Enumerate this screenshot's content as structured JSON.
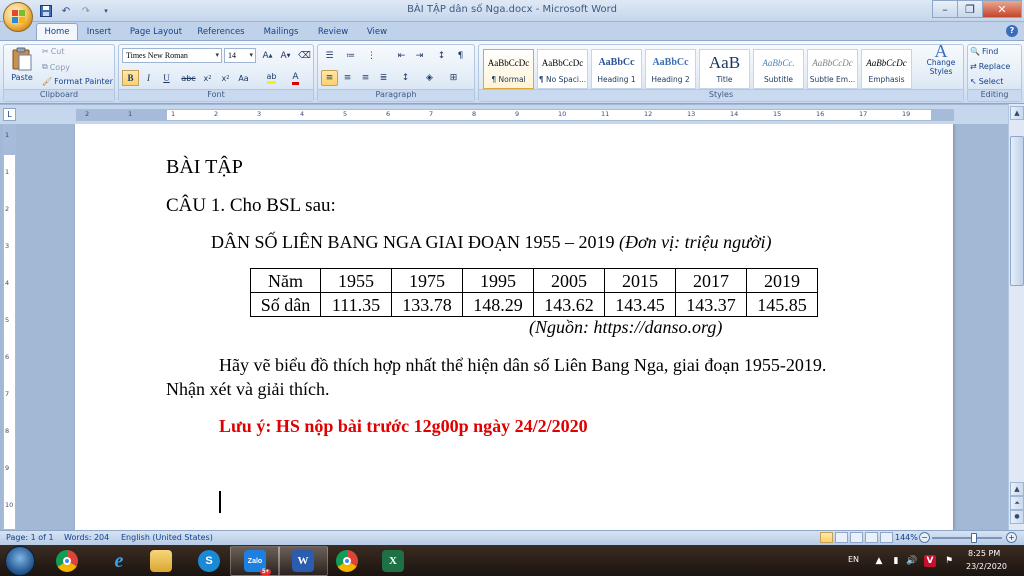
{
  "window": {
    "title": "BÀI TẬP dân số Nga.docx - Microsoft Word"
  },
  "tabs": [
    "Home",
    "Insert",
    "Page Layout",
    "References",
    "Mailings",
    "Review",
    "View"
  ],
  "ribbon": {
    "clipboard": {
      "paste": "Paste",
      "cut": "Cut",
      "copy": "Copy",
      "format_painter": "Format Painter",
      "label": "Clipboard"
    },
    "font": {
      "name": "Times New Roman",
      "size": "14",
      "label": "Font"
    },
    "paragraph": {
      "label": "Paragraph"
    },
    "styles": {
      "items": [
        {
          "sample": "AaBbCcDc",
          "name": "¶ Normal"
        },
        {
          "sample": "AaBbCcDc",
          "name": "¶ No Spaci..."
        },
        {
          "sample": "AaBbCc",
          "name": "Heading 1"
        },
        {
          "sample": "AaBbCc",
          "name": "Heading 2"
        },
        {
          "sample": "AaB",
          "name": "Title"
        },
        {
          "sample": "AaBbCc.",
          "name": "Subtitle"
        },
        {
          "sample": "AaBbCcDc",
          "name": "Subtle Em..."
        },
        {
          "sample": "AaBbCcDc",
          "name": "Emphasis"
        }
      ],
      "change_styles": "Change Styles",
      "label": "Styles"
    },
    "editing": {
      "find": "Find",
      "replace": "Replace",
      "select": "Select",
      "label": "Editing"
    }
  },
  "ruler": {
    "numbers": [
      "2",
      "1",
      "1",
      "2",
      "3",
      "4",
      "5",
      "6",
      "7",
      "8",
      "9",
      "10",
      "11",
      "12",
      "13",
      "14",
      "15",
      "16",
      "17",
      "19"
    ]
  },
  "vruler": {
    "numbers": [
      "1",
      "1",
      "2",
      "3",
      "4",
      "5",
      "6",
      "7",
      "8",
      "9",
      "10"
    ]
  },
  "document": {
    "heading": "BÀI TẬP",
    "question": "CÂU 1. Cho BSL sau:",
    "table_title_main": "DÂN SỐ LIÊN BANG NGA GIAI ĐOẠN 1955 – 2019",
    "table_title_unit": "(Đơn vị: triệu người)",
    "table": {
      "row1_header": "Năm",
      "row2_header": "Số dân",
      "years": [
        "1955",
        "1975",
        "1995",
        "2005",
        "2015",
        "2017",
        "2019"
      ],
      "values": [
        "111.35",
        "133.78",
        "148.29",
        "143.62",
        "143.45",
        "143.37",
        "145.85"
      ]
    },
    "source": "(Nguồn: https://danso.org)",
    "instruction_line1": "Hãy vẽ biểu đồ thích hợp nhất thể hiện dân số Liên Bang Nga, giai đoạn 1955-2019.",
    "instruction_line2": "Nhận xét và giải thích.",
    "note": "Lưu ý: HS nộp bài trước 12g00p ngày 24/2/2020"
  },
  "statusbar": {
    "page": "Page: 1 of 1",
    "words": "Words: 204",
    "language": "English (United States)",
    "zoom": "144%",
    "zoom_level": 0.6
  },
  "taskbar": {
    "language": "EN",
    "time": "8:25 PM",
    "date": "23/2/2020",
    "zalo_badge": "5+"
  },
  "colors": {
    "note_red": "#e00000"
  }
}
